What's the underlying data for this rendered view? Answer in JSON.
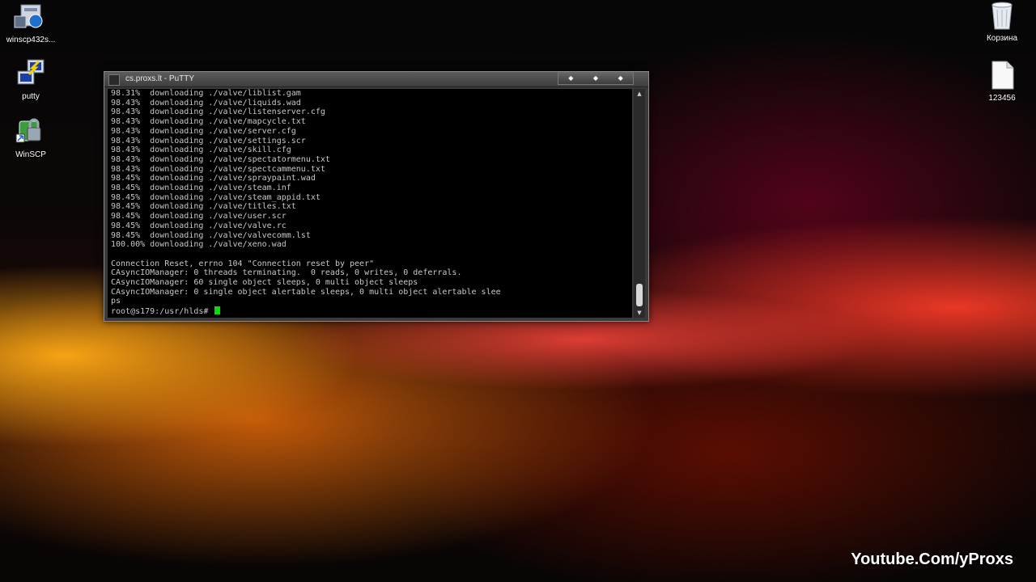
{
  "desktop_icons_left": [
    {
      "label": "winscp432s...",
      "icon": "installer-icon"
    },
    {
      "label": "putty",
      "icon": "putty-icon"
    },
    {
      "label": "WinSCP",
      "icon": "winscp-icon"
    }
  ],
  "desktop_icons_right": [
    {
      "label": "Корзина",
      "icon": "recycle-bin-icon"
    },
    {
      "label": "123456",
      "icon": "text-file-icon"
    }
  ],
  "window": {
    "title": "cs.proxs.lt - PuTTY",
    "controls": [
      "minimize",
      "maximize",
      "close"
    ]
  },
  "terminal": {
    "lines": [
      "98.31%  downloading ./valve/liblist.gam",
      "98.43%  downloading ./valve/liquids.wad",
      "98.43%  downloading ./valve/listenserver.cfg",
      "98.43%  downloading ./valve/mapcycle.txt",
      "98.43%  downloading ./valve/server.cfg",
      "98.43%  downloading ./valve/settings.scr",
      "98.43%  downloading ./valve/skill.cfg",
      "98.43%  downloading ./valve/spectatormenu.txt",
      "98.43%  downloading ./valve/spectcammenu.txt",
      "98.45%  downloading ./valve/spraypaint.wad",
      "98.45%  downloading ./valve/steam.inf",
      "98.45%  downloading ./valve/steam_appid.txt",
      "98.45%  downloading ./valve/titles.txt",
      "98.45%  downloading ./valve/user.scr",
      "98.45%  downloading ./valve/valve.rc",
      "98.45%  downloading ./valve/valvecomm.lst",
      "100.00% downloading ./valve/xeno.wad",
      "",
      "Connection Reset, errno 104 \"Connection reset by peer\"",
      "CAsyncIOManager: 0 threads terminating.  0 reads, 0 writes, 0 deferrals.",
      "CAsyncIOManager: 60 single object sleeps, 0 multi object sleeps",
      "CAsyncIOManager: 0 single object alertable sleeps, 0 multi object alertable slee",
      "ps"
    ],
    "prompt": "root@s179:/usr/hlds# "
  },
  "watermark": "Youtube.Com/yProxs"
}
